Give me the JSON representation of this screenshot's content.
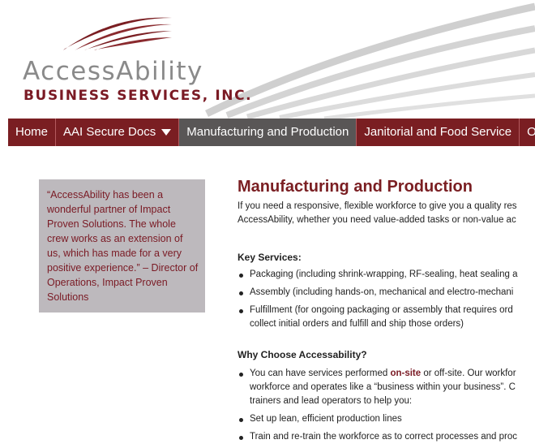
{
  "logo": {
    "wordmark": "AccessAbility",
    "subtitle": "BUSINESS SERVICES, INC."
  },
  "colors": {
    "brand": "#7a1e22",
    "nav_active": "#595656",
    "quote_bg": "#bdb9bd",
    "swoosh_gray": "#c9c9c9"
  },
  "nav": {
    "items": [
      {
        "label": "Home",
        "active": false
      },
      {
        "label": "AAI Secure Docs",
        "active": false,
        "icon": "caret-down-icon"
      },
      {
        "label": "Manufacturing and Production",
        "active": true
      },
      {
        "label": "Janitorial and Food Service",
        "active": false
      },
      {
        "label": "On",
        "active": false
      }
    ]
  },
  "quote": {
    "text": "“AccessAbility has been a wonderful partner of Impact Proven Solutions. The whole crew works as an extension of us, which has made for a very positive experience.” – Director of Operations, Impact Proven Solutions"
  },
  "main": {
    "title": "Manufacturing and Production",
    "intro_lines": [
      "If you need a responsive, flexible workforce to give you a quality res",
      "AccessAbility, whether you need value-added tasks or non-value ac"
    ],
    "key_services": {
      "heading": "Key Services:",
      "items": [
        {
          "lines": [
            "Packaging (including shrink-wrapping, RF-sealing, heat sealing a"
          ]
        },
        {
          "lines": [
            "Assembly (including hands-on, mechanical and electro-mechani"
          ]
        },
        {
          "lines": [
            "Fulfillment (for ongoing packaging or assembly that requires ord",
            "collect initial orders and fulfill and ship those orders)"
          ]
        }
      ]
    },
    "why_choose": {
      "heading": "Why Choose Accessability?",
      "item1": {
        "prefix": "You can have services performed ",
        "highlight": "on-site",
        "suffix": " or off-site. Our workfor",
        "line2": "workforce and operates like a “business within your business”. C",
        "line3": "trainers and lead operators to help you:"
      },
      "item2": "Set up lean, efficient production lines",
      "item3": "Train and re-train the workforce as to correct processes and proc"
    }
  }
}
